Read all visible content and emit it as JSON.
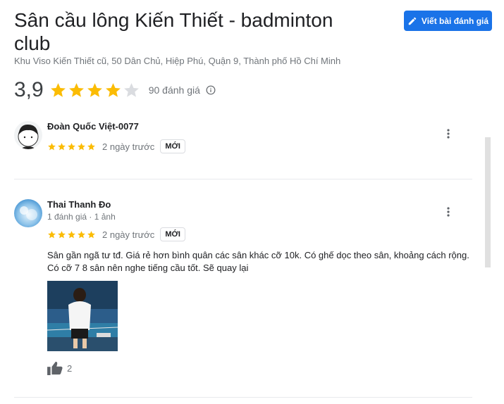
{
  "place": {
    "title": "Sân cầu lông Kiến Thiết - badminton club",
    "address": "Khu Viso Kiến Thiết cũ, 50 Dân Chủ, Hiệp Phú, Quận 9, Thành phố Hồ Chí Minh",
    "rating": "3,9",
    "rating_value": 3.9,
    "review_count": "90 đánh giá"
  },
  "write_review_label": "Viết bài đánh giá",
  "colors": {
    "accent": "#1a73e8",
    "star": "#fbbc04",
    "star_empty": "#dadce0"
  },
  "icons": {
    "write": "pencil-icon",
    "info": "info-icon",
    "more": "more-vert-icon",
    "like": "thumb-up-icon"
  },
  "reviews": [
    {
      "name": "Đoàn Quốc Việt-0077",
      "meta": "",
      "stars": 5,
      "time": "2 ngày trước",
      "badge": "MỚI",
      "text": ""
    },
    {
      "name": "Thai Thanh Đo",
      "meta": "1 đánh giá · 1 ảnh",
      "stars": 5,
      "time": "2 ngày trước",
      "badge": "MỚI",
      "text": "Sân gần ngã tư tđ. Giá rẻ hơn bình quân các sân khác cỡ 10k. Có ghế dọc theo sân, khoảng cách rộng. Có cỡ 7 8 sân nên nghe tiếng cầu tốt. Sẽ quay lại",
      "likes": "2"
    }
  ]
}
